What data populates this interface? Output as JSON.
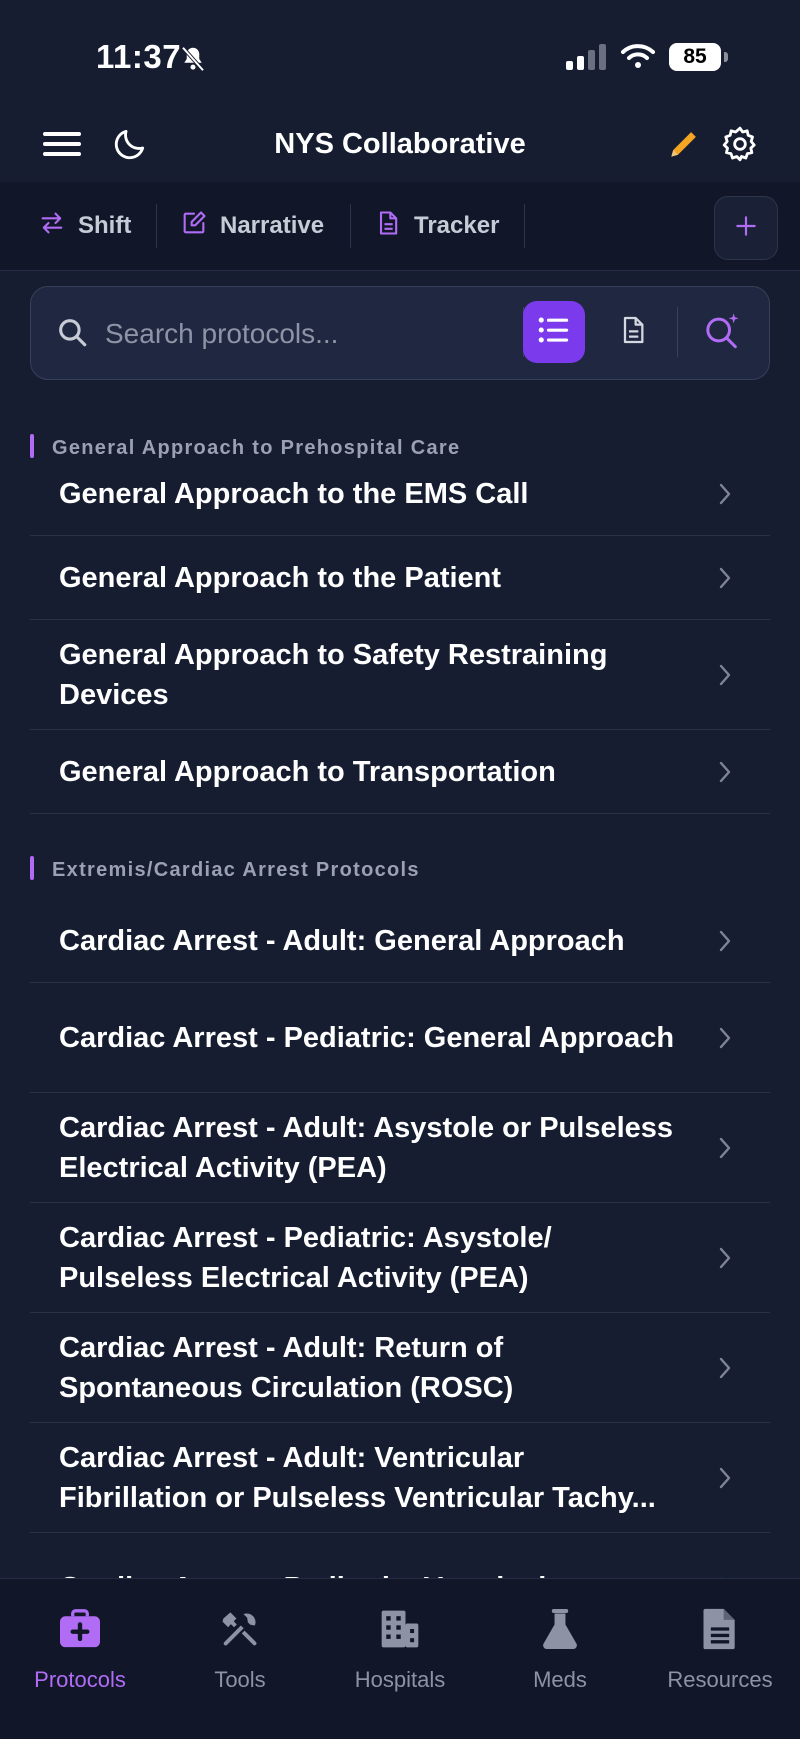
{
  "status_bar": {
    "time": "11:37",
    "battery": "85"
  },
  "header": {
    "title": "NYS Collaborative"
  },
  "quick_tabs": [
    {
      "label": "Shift",
      "icon": "swap-arrows-icon"
    },
    {
      "label": "Narrative",
      "icon": "edit-note-icon"
    },
    {
      "label": "Tracker",
      "icon": "document-icon"
    }
  ],
  "search": {
    "placeholder": "Search protocols..."
  },
  "sections": [
    {
      "title": "General Approach to Prehospital Care",
      "items": [
        "General Approach to the EMS Call",
        "General Approach to the Patient",
        "General Approach to Safety Restraining Devices",
        "General Approach to Transportation"
      ]
    },
    {
      "title": "Extremis/Cardiac Arrest Protocols",
      "items": [
        "Cardiac Arrest - Adult: General Approach",
        "Cardiac Arrest - Pediatric: General Approach",
        "Cardiac Arrest - Adult: Asystole or Pulseless Electrical Activity (PEA)",
        "Cardiac Arrest - Pediatric: Asystole/ Pulseless Electrical Activity (PEA)",
        "Cardiac Arrest - Adult: Return of Spontaneous Circulation (ROSC)",
        "Cardiac Arrest - Adult: Ventricular Fibrillation or Pulseless Ventricular Tachy...",
        "Cardiac Arrest - Pediatric: Ventricular"
      ]
    }
  ],
  "bottom_nav": [
    {
      "label": "Protocols",
      "icon": "medkit-icon",
      "active": true
    },
    {
      "label": "Tools",
      "icon": "tools-icon",
      "active": false
    },
    {
      "label": "Hospitals",
      "icon": "hospital-icon",
      "active": false
    },
    {
      "label": "Meds",
      "icon": "flask-icon",
      "active": false
    },
    {
      "label": "Resources",
      "icon": "file-icon",
      "active": false
    }
  ],
  "colors": {
    "accent": "#7c3aed",
    "accent_light": "#b06cf5",
    "pencil": "#f5a524",
    "background": "#161d31"
  }
}
